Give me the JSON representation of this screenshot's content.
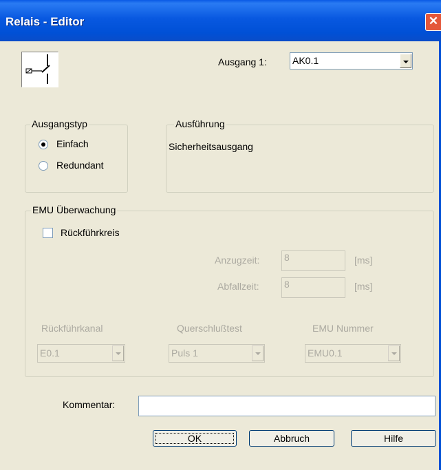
{
  "window": {
    "title": "Relais - Editor",
    "close_glyph": "✕"
  },
  "icon": "relay-contact-icon",
  "output": {
    "label": "Ausgang 1:",
    "value": "AK0.1"
  },
  "ausgangstyp": {
    "title": "Ausgangstyp",
    "options": [
      {
        "label": "Einfach",
        "checked": true
      },
      {
        "label": "Redundant",
        "checked": false
      }
    ]
  },
  "ausfuehrung": {
    "title": "Ausführung",
    "value": "Sicherheitsausgang"
  },
  "emu": {
    "title": "EMU Überwachung",
    "rueckfuehrkreis_label": "Rückführkreis",
    "anzugzeit": {
      "label": "Anzugzeit:",
      "value": "8",
      "unit": "[ms]"
    },
    "abfallzeit": {
      "label": "Abfallzeit:",
      "value": "8",
      "unit": "[ms]"
    },
    "rueckfuehrkanal": {
      "label": "Rückführkanal",
      "value": "E0.1"
    },
    "querschlusstest": {
      "label": "Querschlußtest",
      "value": "Puls 1"
    },
    "emu_nummer": {
      "label": "EMU Nummer",
      "value": "EMU0.1"
    }
  },
  "kommentar": {
    "label": "Kommentar:",
    "value": ""
  },
  "buttons": {
    "ok": "OK",
    "cancel": "Abbruch",
    "help": "Hilfe"
  }
}
